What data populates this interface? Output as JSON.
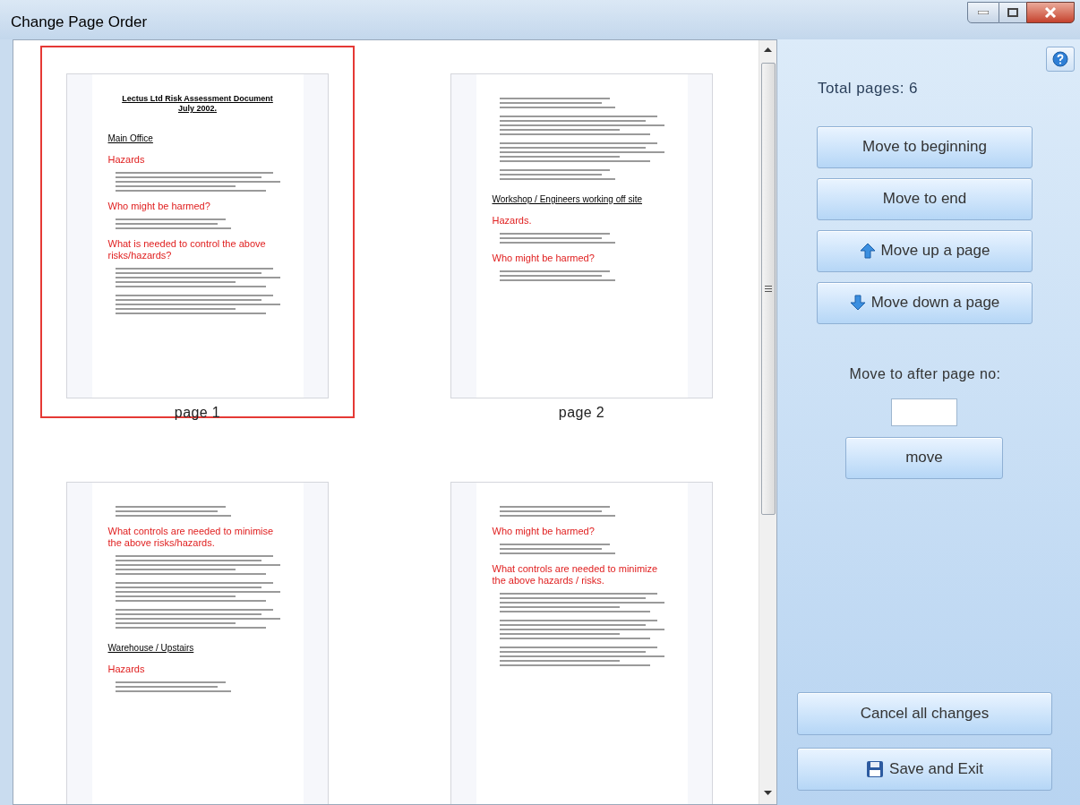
{
  "window": {
    "title": "Change Page Order"
  },
  "pages": [
    {
      "label": "page 1",
      "selected": true,
      "blocks": [
        {
          "kind": "title",
          "text": "Lectus Ltd Risk Assessment Document July 2002."
        },
        {
          "kind": "section",
          "text": "Main Office"
        },
        {
          "kind": "heading",
          "text": "Hazards"
        },
        {
          "kind": "body"
        },
        {
          "kind": "heading",
          "text": "Who might be harmed?"
        },
        {
          "kind": "list"
        },
        {
          "kind": "heading",
          "text": "What is needed to control the above risks/hazards?"
        },
        {
          "kind": "body"
        },
        {
          "kind": "body"
        }
      ]
    },
    {
      "label": "page 2",
      "selected": false,
      "blocks": [
        {
          "kind": "list"
        },
        {
          "kind": "body"
        },
        {
          "kind": "body"
        },
        {
          "kind": "list"
        },
        {
          "kind": "section",
          "text": "Workshop / Engineers working off site"
        },
        {
          "kind": "heading",
          "text": "Hazards."
        },
        {
          "kind": "list"
        },
        {
          "kind": "heading",
          "text": "Who might be harmed?"
        },
        {
          "kind": "list"
        }
      ]
    },
    {
      "selected": false,
      "blocks": [
        {
          "kind": "list"
        },
        {
          "kind": "heading",
          "text": "What controls are needed to minimise the above risks/hazards."
        },
        {
          "kind": "body"
        },
        {
          "kind": "body"
        },
        {
          "kind": "body"
        },
        {
          "kind": "section",
          "text": "Warehouse / Upstairs"
        },
        {
          "kind": "heading",
          "text": "Hazards"
        },
        {
          "kind": "list"
        }
      ]
    },
    {
      "selected": false,
      "blocks": [
        {
          "kind": "list"
        },
        {
          "kind": "heading",
          "text": "Who might be harmed?"
        },
        {
          "kind": "list"
        },
        {
          "kind": "heading",
          "text": "What controls are needed to minimize the above hazards / risks."
        },
        {
          "kind": "body"
        },
        {
          "kind": "body"
        },
        {
          "kind": "body"
        }
      ]
    }
  ],
  "panel": {
    "total": "Total pages: 6",
    "buttons": [
      {
        "label": "Move to beginning",
        "kind": "plain"
      },
      {
        "label": "Move to end",
        "kind": "plain"
      },
      {
        "label": "Move up a page",
        "kind": "up"
      },
      {
        "label": "Move down a page",
        "kind": "down"
      }
    ],
    "after_label": "Move to after page no:",
    "move_button": "move",
    "cancel_button": "Cancel all changes",
    "save_button": "Save and Exit"
  }
}
